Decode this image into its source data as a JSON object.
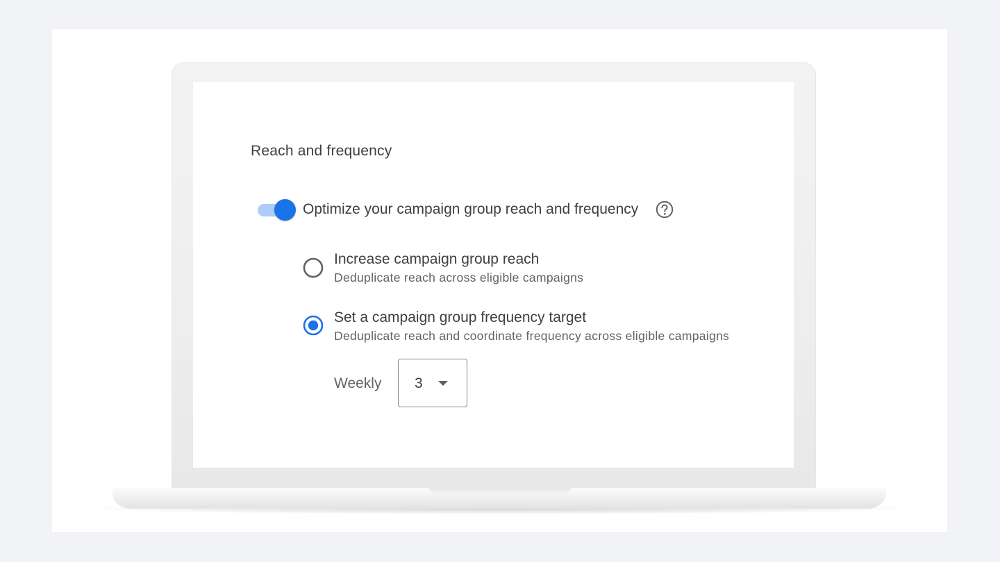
{
  "section": {
    "title": "Reach and frequency"
  },
  "toggle": {
    "label": "Optimize your campaign group reach and frequency",
    "on": true
  },
  "options": [
    {
      "label": "Increase campaign group reach",
      "description": "Deduplicate reach across eligible campaigns",
      "selected": false
    },
    {
      "label": "Set a campaign group frequency target",
      "description": "Deduplicate reach and coordinate frequency across eligible campaigns",
      "selected": true
    }
  ],
  "frequency": {
    "period_label": "Weekly",
    "selected_value": "3"
  },
  "colors": {
    "accent": "#1a73e8",
    "accent_light": "#aecbfa",
    "text_primary": "#3c4043",
    "text_secondary": "#5f6368",
    "outline": "#80868b"
  },
  "icons": {
    "help": "help-circle-icon",
    "dropdown": "caret-down-icon"
  }
}
